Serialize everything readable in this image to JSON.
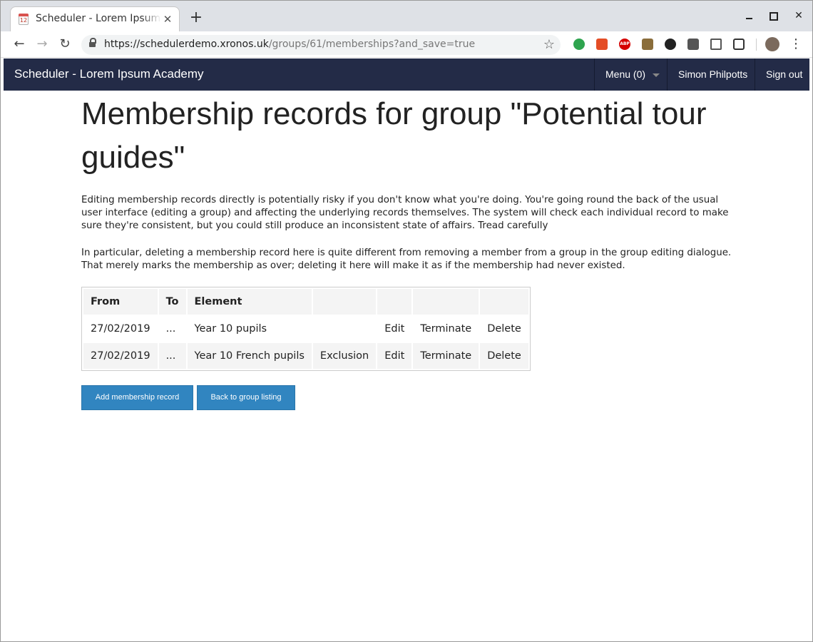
{
  "browser": {
    "tab_title": "Scheduler - Lorem Ipsum Academy",
    "favicon_text": "12",
    "url_host": "https://schedulerdemo.xronos.uk",
    "url_path": "/groups/61/memberships?and_save=true",
    "extension_abp_label": "ABP"
  },
  "navbar": {
    "brand": "Scheduler - Lorem Ipsum Academy",
    "menu_label": "Menu (0)",
    "user_name": "Simon Philpotts",
    "signout_label": "Sign out"
  },
  "page": {
    "title": "Membership records for group \"Potential tour guides\"",
    "paragraph1": "Editing membership records directly is potentially risky if you don't know what you're doing. You're going round the back of the usual user interface (editing a group) and affecting the underlying records themselves. The system will check each individual record to make sure they're consistent, but you could still produce an inconsistent state of affairs. Tread carefully",
    "paragraph2": "In particular, deleting a membership record here is quite different from removing a member from a group in the group editing dialogue. That merely marks the membership as over; deleting it here will make it as if the membership had never existed."
  },
  "table": {
    "headers": [
      "From",
      "To",
      "Element",
      "",
      "",
      "",
      ""
    ],
    "rows": [
      {
        "from": "27/02/2019",
        "to": "...",
        "element": "Year 10 pupils",
        "flag": "",
        "edit": "Edit",
        "terminate": "Terminate",
        "delete": "Delete"
      },
      {
        "from": "27/02/2019",
        "to": "...",
        "element": "Year 10 French pupils",
        "flag": "Exclusion",
        "edit": "Edit",
        "terminate": "Terminate",
        "delete": "Delete"
      }
    ]
  },
  "buttons": {
    "add_label": "Add membership record",
    "back_label": "Back to group listing"
  }
}
